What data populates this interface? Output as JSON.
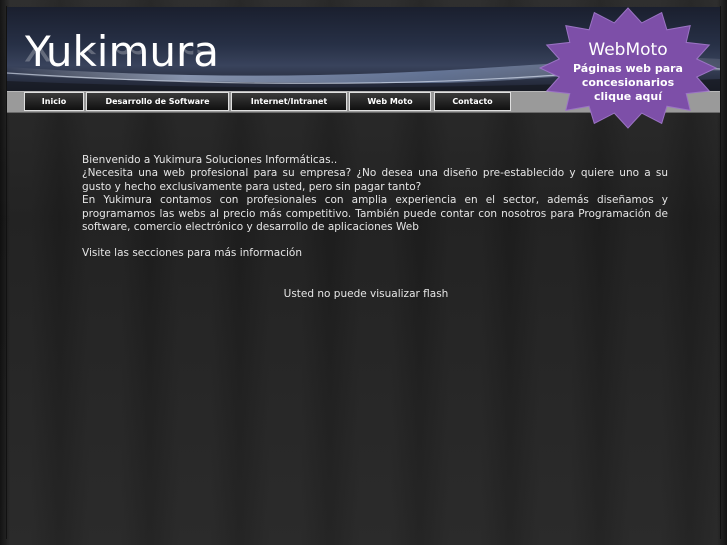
{
  "header": {
    "logo_text": "Yukimura"
  },
  "nav": {
    "items": [
      {
        "label": "Inicio"
      },
      {
        "label": "Desarrollo de Software"
      },
      {
        "label": "Internet/Intranet"
      },
      {
        "label": "Web Moto"
      },
      {
        "label": "Contacto"
      }
    ]
  },
  "badge": {
    "title": "WebMoto",
    "line1": "Páginas web para",
    "line2": "concesionarios",
    "line3": "clique aquí",
    "color": "#7d4fa8"
  },
  "content": {
    "line1": "Bienvenido a Yukimura Soluciones Informáticas..",
    "para1": "¿Necesita una web profesional para su empresa? ¿No desea una diseño pre-establecido y quiere uno a su gusto y hecho exclusivamente para usted, pero sin pagar tanto?",
    "para2": "En Yukimura contamos con profesionales con amplia experiencia en el sector, además diseñamos y programamos las webs al precio más competitivo. También puede contar con nosotros para Programación de software, comercio electrónico y desarrollo de aplicaciones Web",
    "para3": "Visite las secciones para más información",
    "flash_notice": "Usted no puede visualizar flash"
  }
}
